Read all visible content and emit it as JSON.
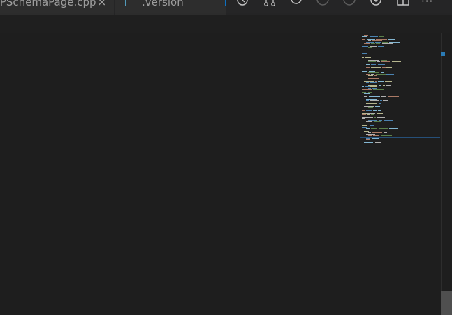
{
  "tabs": [
    {
      "label": "OPSchemaPage.cpp",
      "close": "×",
      "icon": "close-icon"
    },
    {
      "label": ".version",
      "icon": "file-icon"
    }
  ],
  "editor_actions": [
    {
      "name": "timeline-icon",
      "enabled": true
    },
    {
      "name": "source-control-icon",
      "enabled": true
    },
    {
      "name": "sync-changes-icon",
      "enabled": true
    },
    {
      "name": "previous-change-icon",
      "enabled": false
    },
    {
      "name": "next-change-icon",
      "enabled": false
    },
    {
      "name": "compare-icon",
      "enabled": true
    },
    {
      "name": "split-editor-icon",
      "enabled": true
    }
  ],
  "more_label": "···",
  "colors": {
    "editor_bg": "#1e1e1e",
    "tab_bg": "#2d2d2d",
    "accent": "#0e70c0",
    "minimap_keyword": "#569cd6",
    "minimap_string": "#ce9178",
    "minimap_identifier": "#9cdcfe",
    "minimap_function": "#dcdcaa"
  }
}
